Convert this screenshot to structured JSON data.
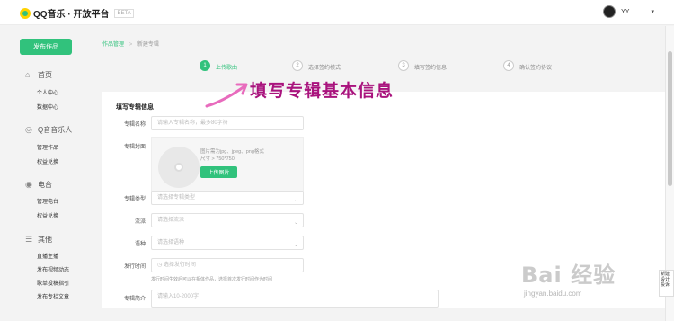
{
  "header": {
    "logo_text": "QQ音乐 · 开放平台",
    "logo_badge": "BETA",
    "username": "YY",
    "caret": "▾"
  },
  "sidebar": {
    "publish_label": "发布作品",
    "groups": [
      {
        "title": "首页",
        "icon": "home-icon",
        "items": [
          "个人中心",
          "数据中心"
        ]
      },
      {
        "title": "Q音音乐人",
        "icon": "musician-icon",
        "items": [
          "管理作品",
          "权益兑换"
        ]
      },
      {
        "title": "电台",
        "icon": "radio-icon",
        "items": [
          "管理电台",
          "权益兑换"
        ]
      },
      {
        "title": "其他",
        "icon": "menu-icon",
        "items": [
          "直播主播",
          "发布视频动态",
          "歌单投稿指引",
          "发布专栏文章"
        ]
      }
    ]
  },
  "breadcrumb": {
    "home": "作品管理",
    "sep": ">",
    "current": "新建专辑"
  },
  "steps": [
    {
      "num": "1",
      "label": "上传歌曲",
      "active": true
    },
    {
      "num": "2",
      "label": "选择签约模式",
      "active": false
    },
    {
      "num": "3",
      "label": "填写签约信息",
      "active": false
    },
    {
      "num": "4",
      "label": "确认签约协议",
      "active": false
    }
  ],
  "annotation": "填写专辑基本信息",
  "form": {
    "section_title": "填写专辑信息",
    "name_label": "专辑名称",
    "name_placeholder": "请输入专辑名称，最多80字符",
    "cover_label": "专辑封面",
    "cover_hint_1": "图片需为jpg、jpeg、png格式",
    "cover_hint_2": "尺寸 > 750*750",
    "upload_label": "上传图片",
    "type_label": "专辑类型",
    "type_placeholder": "请选择专辑类型",
    "genre_label": "流派",
    "genre_placeholder": "请选择流派",
    "lang_label": "语种",
    "lang_placeholder": "请选择语种",
    "date_label": "发行时间",
    "date_placeholder": "选择发行时间",
    "date_hint": "发行时间生效后可以在相体作品，选择首次发行时间作为时间",
    "intro_label": "专辑简介",
    "intro_placeholder": "请输入10-2000字"
  },
  "watermark": {
    "text": "Bai 经验",
    "url": "jingyan.baidu.com"
  },
  "side_widget": "新建 设计 投诉"
}
